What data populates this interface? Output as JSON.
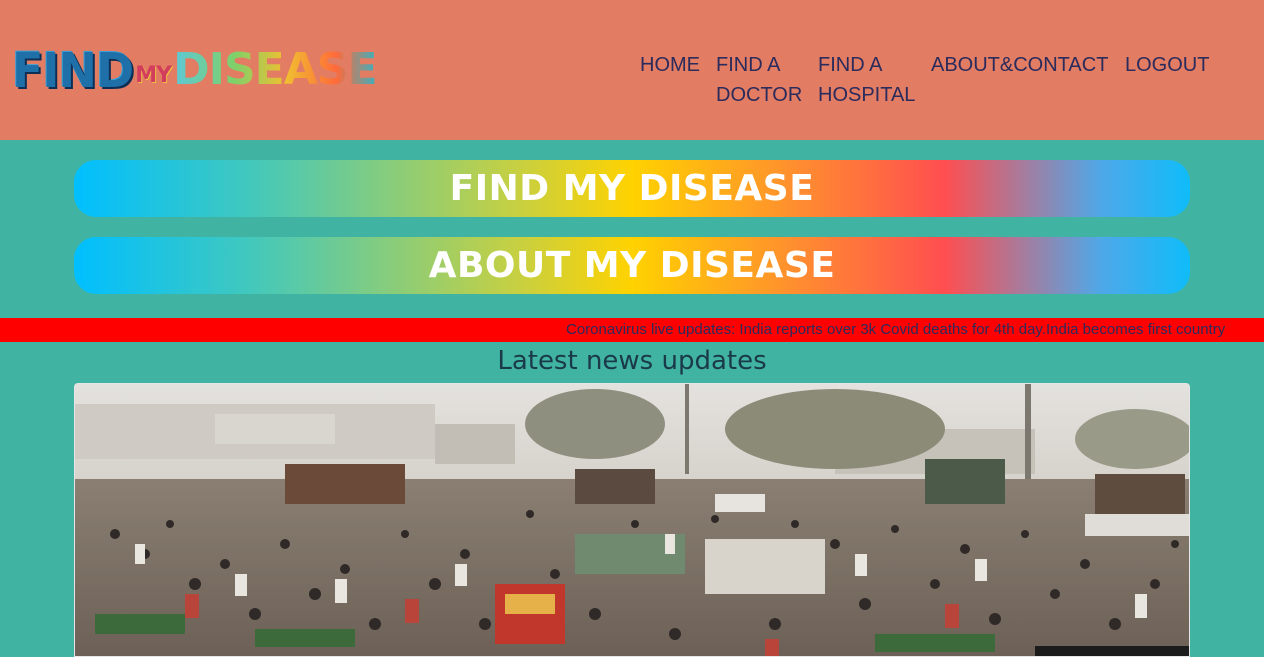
{
  "header": {
    "logo": {
      "part1": "FIND",
      "part2": "MY",
      "part3": "DISEASE"
    },
    "nav": [
      {
        "label": "HOME"
      },
      {
        "label": "FIND A DOCTOR"
      },
      {
        "label": "FIND A HOSPITAL"
      },
      {
        "label": "ABOUT&CONTACT"
      },
      {
        "label": "LOGOUT"
      }
    ]
  },
  "main": {
    "find_button_label": "FIND MY DISEASE",
    "about_button_label": "ABOUT MY DISEASE",
    "ticker_text": "Coronavirus live updates: India reports over 3k Covid deaths for 4th day.India becomes first country",
    "news_heading": "Latest news updates",
    "news_image_icon": "crowded-market-photo"
  },
  "colors": {
    "header_bg": "#e27c62",
    "page_bg": "#41b3a3",
    "ticker_bg": "#ff0000",
    "nav_text": "#2b2b5c"
  }
}
